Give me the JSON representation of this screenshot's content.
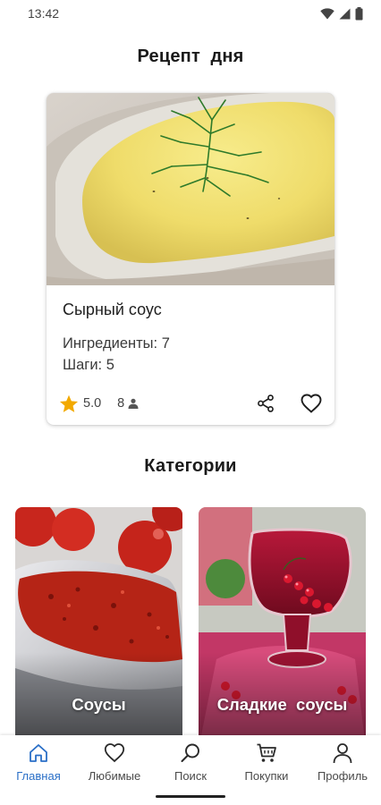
{
  "status_bar": {
    "time": "13:42"
  },
  "recipe_of_day": {
    "section_title": "Рецепт  дня",
    "name": "Сырный соус",
    "ingredients": "Ингредиенты: 7",
    "steps": "Шаги: 5",
    "rating": "5.0",
    "people": "8",
    "star_color": "#f2a900"
  },
  "categories": {
    "section_title": "Категории",
    "items": [
      {
        "label": "Соусы"
      },
      {
        "label": "Сладкие  соусы"
      }
    ]
  },
  "bottom_nav": {
    "accent_color": "#2a6fc7",
    "items": [
      {
        "label": "Главная",
        "icon": "home-icon",
        "active": true
      },
      {
        "label": "Любимые",
        "icon": "heart-icon",
        "active": false
      },
      {
        "label": "Поиск",
        "icon": "search-icon",
        "active": false
      },
      {
        "label": "Покупки",
        "icon": "cart-icon",
        "active": false
      },
      {
        "label": "Профиль",
        "icon": "person-icon",
        "active": false
      }
    ]
  }
}
